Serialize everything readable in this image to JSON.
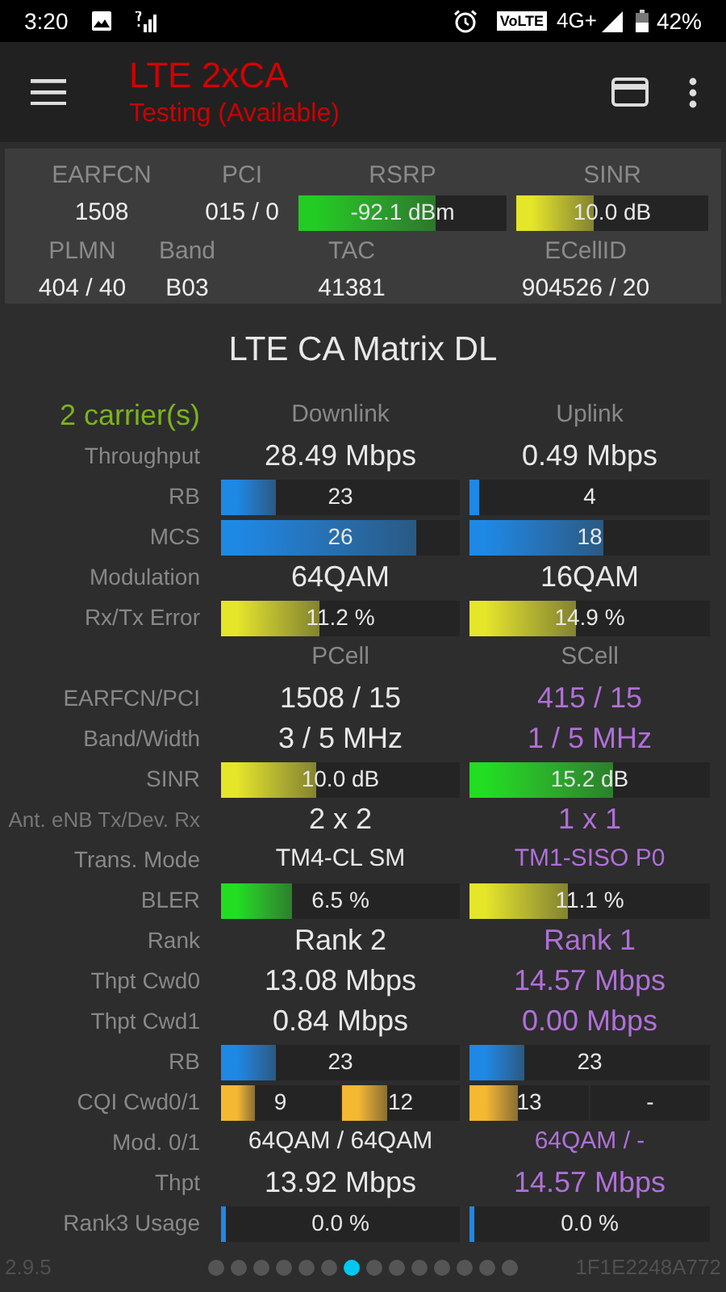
{
  "status_bar": {
    "time": "3:20",
    "volte": "VoLTE",
    "network": "4G+",
    "battery": "42%"
  },
  "toolbar": {
    "title": "LTE 2xCA",
    "subtitle": "Testing (Available)"
  },
  "cell_info": {
    "top": [
      {
        "label": "EARFCN",
        "value": "1508"
      },
      {
        "label": "PCI",
        "value": "015 / 0"
      },
      {
        "label": "RSRP",
        "value": "-92.1 dBm",
        "level": 0.66,
        "color": "#22cc22"
      },
      {
        "label": "SINR",
        "value": "10.0 dB",
        "level": 0.4,
        "color": "#e5e52a"
      }
    ],
    "bottom": [
      {
        "label": "PLMN",
        "value": "404 / 40"
      },
      {
        "label": "Band",
        "value": "B03"
      },
      {
        "label": "TAC",
        "value": "41381"
      },
      {
        "label": "ECellID",
        "value": "904526 / 20"
      }
    ]
  },
  "matrix": {
    "title": "LTE CA Matrix DL",
    "rows": [
      {
        "kind": "header",
        "label": "2 carrier(s)",
        "cells": [
          "Downlink",
          "Uplink"
        ]
      },
      {
        "kind": "text",
        "label": "Throughput",
        "cells": [
          {
            "text": "28.49 Mbps",
            "color": "#e8e8e8"
          },
          {
            "text": "0.49 Mbps",
            "color": "#e8e8e8"
          }
        ]
      },
      {
        "kind": "bar",
        "label": "RB",
        "cells": [
          {
            "text": "23",
            "level": 0.23,
            "color": "#1e88e5"
          },
          {
            "text": "4",
            "level": 0.04,
            "color": "#1e88e5"
          }
        ]
      },
      {
        "kind": "bar",
        "label": "MCS",
        "cells": [
          {
            "text": "26",
            "level": 0.82,
            "color": "#1e88e5"
          },
          {
            "text": "18",
            "level": 0.56,
            "color": "#1e88e5"
          }
        ]
      },
      {
        "kind": "text",
        "label": "Modulation",
        "cells": [
          {
            "text": "64QAM",
            "color": "#e8e8e8"
          },
          {
            "text": "16QAM",
            "color": "#e8e8e8"
          }
        ]
      },
      {
        "kind": "bar",
        "label": "Rx/Tx Error",
        "cells": [
          {
            "text": "11.2 %",
            "level": 0.41,
            "color": "#e5e52a"
          },
          {
            "text": "14.9 %",
            "level": 0.44,
            "color": "#e5e52a"
          }
        ]
      },
      {
        "kind": "header",
        "cells": [
          "PCell",
          "SCell"
        ]
      },
      {
        "kind": "text",
        "label": "EARFCN/PCI",
        "cells": [
          {
            "text": "1508 / 15",
            "color": "#e8e8e8"
          },
          {
            "text": "415 / 15",
            "color": "#b070d8"
          }
        ]
      },
      {
        "kind": "text",
        "label": "Band/Width",
        "cells": [
          {
            "text": "3 / 5 MHz",
            "color": "#e8e8e8"
          },
          {
            "text": "1 / 5 MHz",
            "color": "#b070d8"
          }
        ]
      },
      {
        "kind": "bar",
        "label": "SINR",
        "cells": [
          {
            "text": "10.0 dB",
            "level": 0.4,
            "color": "#e5e52a"
          },
          {
            "text": "15.2 dB",
            "level": 0.6,
            "color": "#22dd22"
          }
        ]
      },
      {
        "kind": "text",
        "label": "Ant. eNB Tx/Dev. Rx",
        "cells": [
          {
            "text": "2 x 2",
            "color": "#e8e8e8"
          },
          {
            "text": "1 x 1",
            "color": "#b070d8"
          }
        ]
      },
      {
        "kind": "small_text",
        "label": "Trans. Mode",
        "cells": [
          {
            "text": "TM4-CL SM",
            "color": "#e8e8e8"
          },
          {
            "text": "TM1-SISO P0",
            "color": "#b070d8"
          }
        ]
      },
      {
        "kind": "bar",
        "label": "BLER",
        "cells": [
          {
            "text": "6.5 %",
            "level": 0.3,
            "color": "#22dd22"
          },
          {
            "text": "11.1 %",
            "level": 0.41,
            "color": "#e5e52a"
          }
        ]
      },
      {
        "kind": "text",
        "label": "Rank",
        "cells": [
          {
            "text": "Rank 2",
            "color": "#e8e8e8"
          },
          {
            "text": "Rank 1",
            "color": "#b070d8"
          }
        ]
      },
      {
        "kind": "text",
        "label": "Thpt Cwd0",
        "cells": [
          {
            "text": "13.08 Mbps",
            "color": "#e8e8e8"
          },
          {
            "text": "14.57 Mbps",
            "color": "#b070d8"
          }
        ]
      },
      {
        "kind": "text",
        "label": "Thpt Cwd1",
        "cells": [
          {
            "text": "0.84 Mbps",
            "color": "#e8e8e8"
          },
          {
            "text": "0.00 Mbps",
            "color": "#b070d8"
          }
        ]
      },
      {
        "kind": "bar",
        "label": "RB",
        "cells": [
          {
            "text": "23",
            "level": 0.23,
            "color": "#1e88e5"
          },
          {
            "text": "23",
            "level": 0.23,
            "color": "#1e88e5"
          }
        ]
      },
      {
        "kind": "split_bar",
        "label": "CQI Cwd0/1",
        "cells": [
          {
            "bars": [
              {
                "text": "9",
                "level": 0.28,
                "color": "#f5b833"
              },
              {
                "text": "12",
                "level": 0.39,
                "color": "#f5b833"
              }
            ]
          },
          {
            "bars": [
              {
                "text": "13",
                "level": 0.41,
                "color": "#f5b833"
              },
              {
                "text": "-"
              }
            ]
          }
        ]
      },
      {
        "kind": "small_text",
        "label": "Mod. 0/1",
        "cells": [
          {
            "text": "64QAM / 64QAM",
            "color": "#e8e8e8"
          },
          {
            "text": "64QAM / -",
            "color": "#b070d8"
          }
        ]
      },
      {
        "kind": "text",
        "label": "Thpt",
        "cells": [
          {
            "text": "13.92 Mbps",
            "color": "#e8e8e8"
          },
          {
            "text": "14.57 Mbps",
            "color": "#b070d8"
          }
        ]
      },
      {
        "kind": "bar",
        "label": "Rank3 Usage",
        "cells": [
          {
            "text": "0.0 %",
            "level": 0.02,
            "color": "#1e88e5"
          },
          {
            "text": "0.0 %",
            "level": 0.02,
            "color": "#1e88e5"
          }
        ]
      }
    ]
  },
  "pager": {
    "dots": [
      {
        "selected": false
      },
      {
        "selected": false
      },
      {
        "selected": false
      },
      {
        "selected": false
      },
      {
        "selected": false
      },
      {
        "selected": false
      },
      {
        "selected": true
      },
      {
        "selected": false
      },
      {
        "selected": false
      },
      {
        "selected": false
      },
      {
        "selected": false
      },
      {
        "selected": false
      },
      {
        "selected": false
      },
      {
        "selected": false
      }
    ]
  },
  "footer": {
    "version": "2.9.5",
    "device_id": "1F1E2248A772"
  }
}
